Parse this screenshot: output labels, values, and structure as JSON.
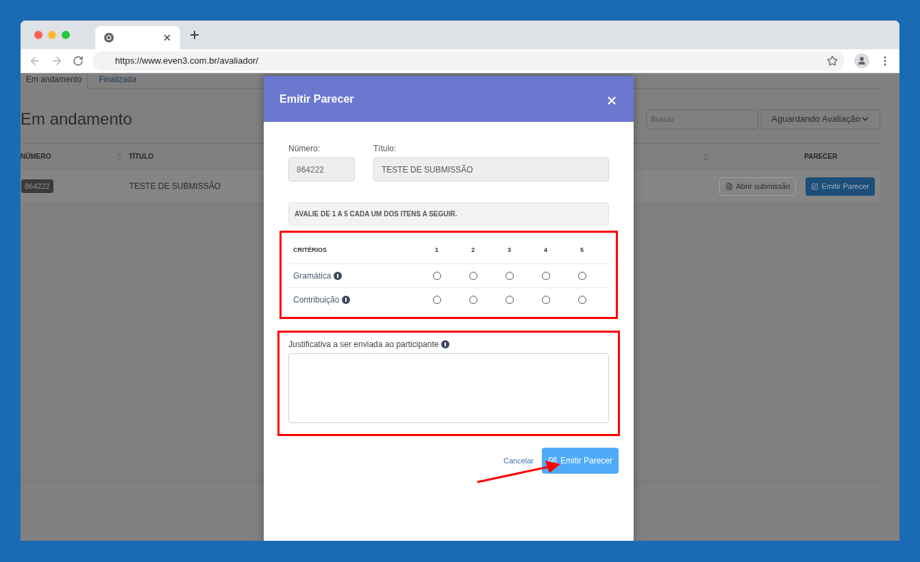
{
  "browser": {
    "url": "https://www.even3.com.br/avaliador/"
  },
  "page": {
    "tabs": [
      {
        "label": "Em andamento",
        "selected": true
      },
      {
        "label": "Finalizada",
        "selected": false
      }
    ],
    "heading": "Em andamento",
    "search": {
      "placeholder": "Buscar"
    },
    "filter": {
      "value": "Aguardando Avaliação"
    },
    "table": {
      "columns": [
        "NÚMERO",
        "TÍTULO",
        "PARECER"
      ],
      "rows": [
        {
          "number": "864222",
          "title": "TESTE DE SUBMISSÃO",
          "open_button": "Abrir submissão",
          "review_button": "Emitir Parecer"
        }
      ]
    }
  },
  "modal": {
    "title": "Emitir Parecer",
    "number": {
      "label": "Número:",
      "value": "864222"
    },
    "title_field": {
      "label": "Título:",
      "value": "TESTE DE SUBMISSÃO"
    },
    "instruction": "AVALIE DE 1 A 5 CADA UM DOS ITENS A SEGUIR.",
    "criteria": {
      "header": "CRITÉRIOS",
      "scale": [
        "1",
        "2",
        "3",
        "4",
        "5"
      ],
      "rows": [
        {
          "label": "Gramática",
          "ratings": [
            {
              "selected": false
            },
            {
              "selected": false
            },
            {
              "selected": false
            },
            {
              "selected": false
            },
            {
              "selected": false
            }
          ]
        },
        {
          "label": "Contribuição",
          "ratings": [
            {
              "selected": false
            },
            {
              "selected": false
            },
            {
              "selected": false
            },
            {
              "selected": false
            },
            {
              "selected": false
            }
          ]
        }
      ]
    },
    "justification": {
      "label": "Justificativa a ser enviada ao participante"
    },
    "cancel": "Cancelar",
    "submit": "Emitir Parecer"
  }
}
